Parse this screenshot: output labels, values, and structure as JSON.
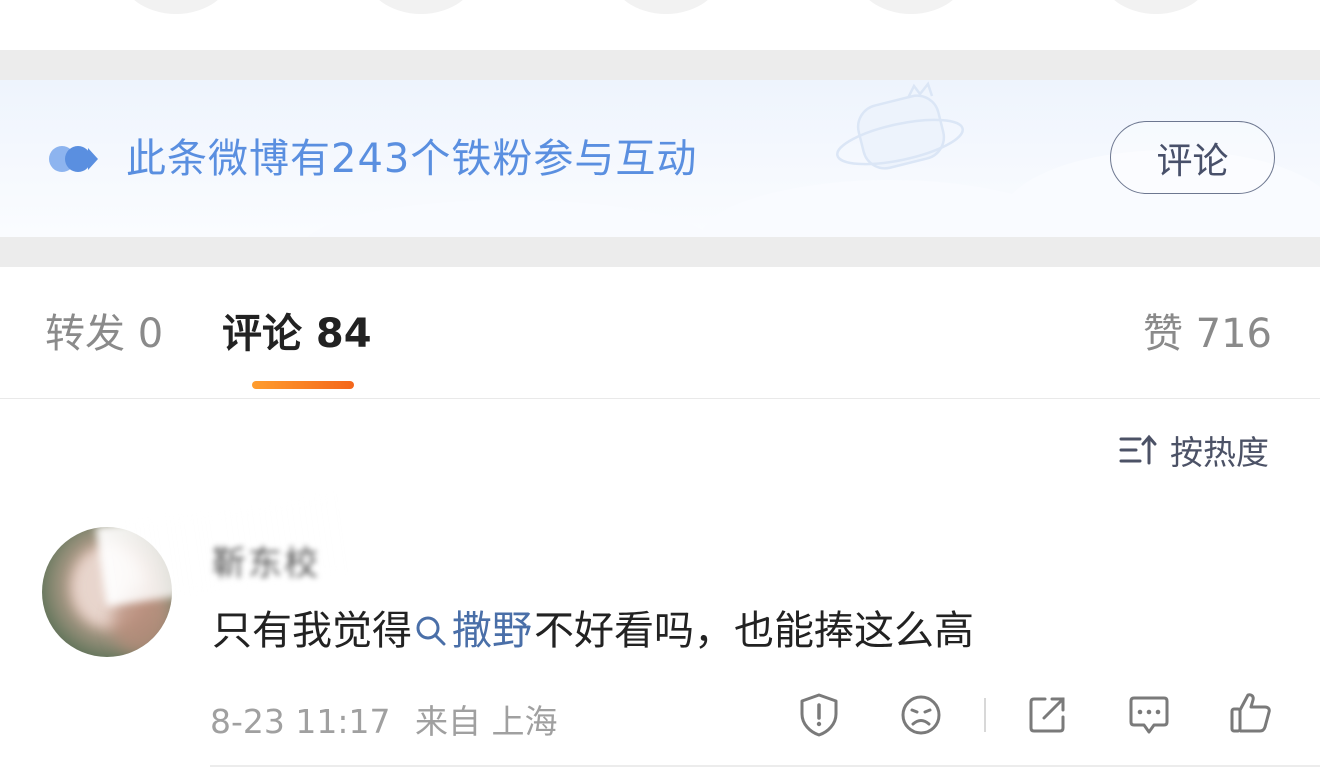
{
  "banner": {
    "text": "此条微博有243个铁粉参与互动",
    "button_label": "评论"
  },
  "tabs": {
    "repost": "转发 0",
    "comment": "评论 84",
    "like": "赞 716"
  },
  "sort": {
    "label": "按热度"
  },
  "comment": {
    "username": "靳东校",
    "text_before": "只有我觉得",
    "topic": "撒野",
    "text_after": "不好看吗，也能捧这么高",
    "time": "8-23 11:17",
    "source": "来自 上海"
  },
  "icons": {
    "banner": "fan-badge-icon",
    "sort": "sort-icon",
    "topic": "search-icon",
    "actions": [
      "report-icon",
      "dislike-icon",
      "share-icon",
      "reply-icon",
      "like-icon"
    ]
  },
  "colors": {
    "accent_blue": "#5a8fe0",
    "tab_indicator": "#f4661b",
    "topic_link": "#4a6fa8"
  }
}
